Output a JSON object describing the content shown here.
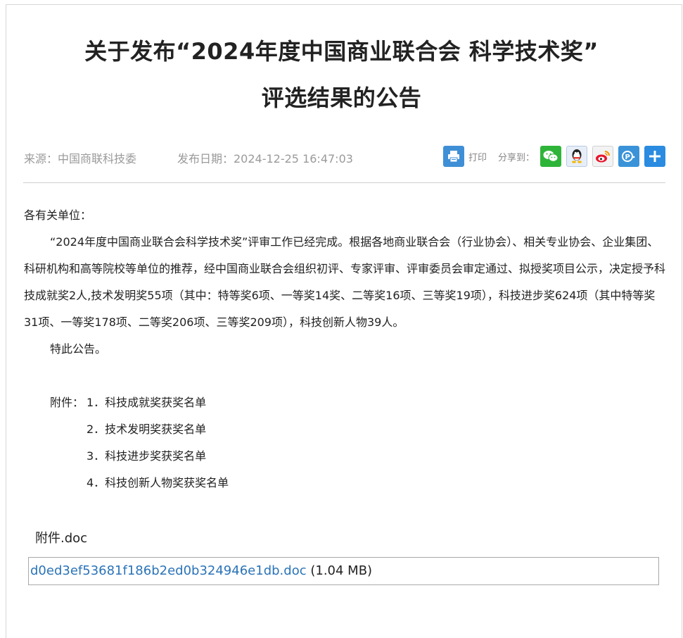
{
  "article": {
    "title_line1": "关于发布“2024年度中国商业联合会 科学技术奖”",
    "title_line2": "评选结果的公告",
    "source": "来源：中国商联科技委",
    "date": "发布日期：2024-12-25 16:47:03"
  },
  "toolbar": {
    "print_label": "打印",
    "share_label": "分享到："
  },
  "content": {
    "greeting": "各有关单位：",
    "paragraph": "“2024年度中国商业联合会科学技术奖”评审工作已经完成。根据各地商业联合会（行业协会）、相关专业协会、企业集团、科研机构和高等院校等单位的推荐，经中国商业联合会组织初评、专家评审、评审委员会审定通过、拟授奖项目公示，决定授予科技成就奖2人,技术发明奖55项（其中：特等奖6项、一等奖14奖、二等奖16项、三等奖19项），科技进步奖624项（其中特等奖31项、一等奖178项、二等奖206项、三等奖209项），科技创新人物39人。",
    "notice": "特此公告。",
    "attachments_label": "附件：",
    "attachments": [
      "1．科技成就奖获奖名单",
      "2．技术发明奖获奖名单",
      "3．科技进步奖获奖名单",
      "4．科技创新人物奖获奖名单"
    ]
  },
  "download": {
    "label": "附件.doc",
    "file_name": "d0ed3ef53681f186b2ed0b324946e1db.doc",
    "file_size": "(1.04 MB)"
  },
  "colors": {
    "link": "#2a73b8",
    "wechat": "#2fb43a",
    "print": "#3f8fd6"
  },
  "icons": [
    "printer-icon",
    "wechat-icon",
    "qq-icon",
    "weibo-icon",
    "qzone-icon",
    "more-share-icon"
  ]
}
